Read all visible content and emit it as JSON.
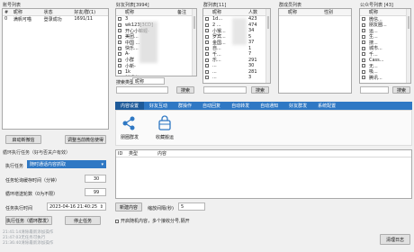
{
  "accounts": {
    "title": "账号列表",
    "headers": [
      "#",
      "昵称",
      "状态",
      "好友/群(1)"
    ],
    "rows": [
      {
        "id": "0",
        "nick": "满帆可喵",
        "status": "登录成功",
        "count": "1691/11"
      }
    ],
    "start_label": "启动新微信",
    "browser_label": "调整当前微信使得"
  },
  "friends": {
    "title": "好友列表[3994]",
    "headers": [
      "昵称",
      "备注"
    ],
    "rows": [
      "3",
      "wk123[3CD]",
      "开心小锦鲤-",
      "美团...",
      "中国 ...",
      "快乐...",
      "A-",
      "小群",
      "小新-",
      "1k",
      "稻期光"
    ],
    "type_label": "搜索类型",
    "type_value": "昵称",
    "search_label": "搜索"
  },
  "groups": {
    "title": "群列表[11]",
    "headers": [
      "昵称",
      "人数"
    ],
    "rows": [
      {
        "name": "1d...",
        "count": "423"
      },
      {
        "name": "2 ...",
        "count": "474"
      },
      {
        "name": "小猴...",
        "count": "34"
      },
      {
        "name": "罗宾...",
        "count": "5"
      },
      {
        "name": "金国...",
        "count": "37"
      },
      {
        "name": "自...",
        "count": "1"
      },
      {
        "name": "千...",
        "count": "7"
      },
      {
        "name": "乐...",
        "count": "291"
      },
      {
        "name": "...",
        "count": "30"
      },
      {
        "name": "...",
        "count": "281"
      },
      {
        "name": "...",
        "count": "3"
      }
    ],
    "search_label": "搜索"
  },
  "members": {
    "title": "群成员列表",
    "headers": [
      "昵称",
      "性别"
    ]
  },
  "official": {
    "title": "公众号列表 [43]",
    "headers": [
      "昵称"
    ],
    "rows": [
      "微信...",
      "朋友圈...",
      "运...",
      "生...",
      "搜...",
      "城市...",
      "千...",
      "Cass...",
      "无...",
      "吸...",
      "腾讯..."
    ],
    "search_label": "搜索"
  },
  "tabs": [
    "内容设置",
    "好友互动",
    "群操作",
    "自动回复",
    "自动转发",
    "自动通知",
    "好友群发",
    "系统配置"
  ],
  "tools": {
    "share_label": "朋圈群发",
    "bag_label": "收藏搬运"
  },
  "loop": {
    "title": "循环执行任务（好与否关户有效）",
    "exec_label": "执行任务",
    "exec_value": "随时通话内容抓取",
    "interval_label": "任务轮询缓存时间（分钟）",
    "interval_value": "30",
    "count_label": "循环增送轮数（0为不限）",
    "count_value": "99",
    "time_label": "任务执行时间",
    "time_value": "2023-04-16 21:40:25",
    "run_label": "执行任务（循环群发）",
    "stop_label": "停止任务"
  },
  "content": {
    "headers": [
      "ID",
      "类型",
      "内容"
    ],
    "add_label": "新建内容",
    "interval_label": "缩放间隔(秒)",
    "interval_value": "5",
    "check_label": "开启随机内容，多个接收分号,隔开"
  },
  "logs": [
    "21:41:14清除最新添加操作",
    "21:47:03无任务可执行",
    "21:36:40清除最新添加操作"
  ],
  "clear_log_label": "清理日志",
  "colors": {
    "tab_bg": "#2f78c4",
    "tab_active": "#1e5a99"
  }
}
